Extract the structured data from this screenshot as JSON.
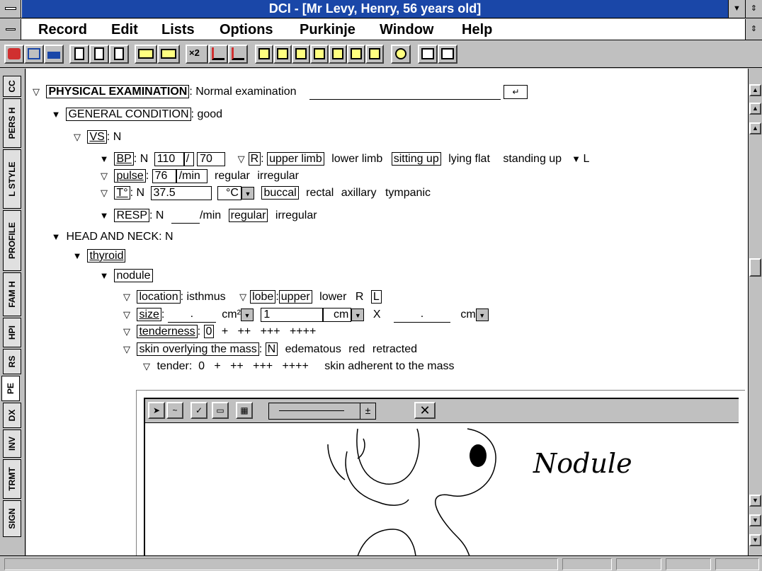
{
  "window": {
    "title": "DCI - [Mr Levy, Henry, 56 years old]",
    "btn_down": "▼",
    "btn_updown": "⇕"
  },
  "menu": {
    "items": [
      "Record",
      "Edit",
      "Lists",
      "Options",
      "Purkinje",
      "Window",
      "Help"
    ]
  },
  "tabs": [
    "CC",
    "PERS H",
    "L STYLE",
    "PROFILE",
    "FAM H",
    "HPI",
    "RS",
    "PE",
    "DX",
    "INV",
    "TRMT",
    "SIGN"
  ],
  "active_tab": "PE",
  "exam": {
    "pe_label": "PHYSICAL EXAMINATION",
    "pe_value": ": Normal examination",
    "general_label": "GENERAL CONDITION",
    "general_value": ": good",
    "vs_label": "VS",
    "vs_value": ": N",
    "bp_label": "BP",
    "bp_n": ": N",
    "bp_sys": "110",
    "bp_slash": "/",
    "bp_dia": "70",
    "bp_r": "R",
    "bp_upper": "upper limb",
    "bp_lower": "lower limb",
    "bp_sitting": "sitting up",
    "bp_lying": "lying flat",
    "bp_standing": "standing up",
    "bp_l": "L",
    "pulse_label": "pulse",
    "pulse_value": "76",
    "pulse_unit": "/min",
    "pulse_regular": "regular",
    "pulse_irregular": "irregular",
    "temp_label": "T°",
    "temp_n": ": N",
    "temp_value": "37.5",
    "temp_unit": "°C",
    "temp_buccal": "buccal",
    "temp_rectal": "rectal",
    "temp_axillary": "axillary",
    "temp_tympanic": "tympanic",
    "resp_label": "RESP",
    "resp_n": ": N",
    "resp_unit": "/min",
    "resp_regular": "regular",
    "resp_irregular": "irregular",
    "head_label": "HEAD AND NECK",
    "head_value": ": N",
    "thyroid_label": "thyroid",
    "nodule_label": "nodule",
    "location_label": "location",
    "location_value": ": isthmus",
    "lobe_label": "lobe",
    "lobe_upper": "upper",
    "lobe_lower": "lower",
    "lobe_r": "R",
    "lobe_l": "L",
    "size_label": "size",
    "size_dot1": ".",
    "size_unit1": "cm²",
    "size_value2": "1",
    "size_unit2": "cm",
    "size_x": "X",
    "size_dot3": ".",
    "size_unit3": "cm",
    "tenderness_label": "tenderness",
    "tenderness_value": "0",
    "tenderness_opts": "+   ++   +++   ++++",
    "skin_label": "skin overlying the mass",
    "skin_n": "N",
    "skin_edematous": "edematous",
    "skin_red": "red",
    "skin_retracted": "retracted",
    "tender_row": "tender:  0   +   ++   +++   ++++",
    "skin_adherent": "skin adherent to the mass"
  },
  "drawing": {
    "annotation": "Nodule",
    "close_glyph": "✕",
    "dropdown_glyph": "±"
  }
}
